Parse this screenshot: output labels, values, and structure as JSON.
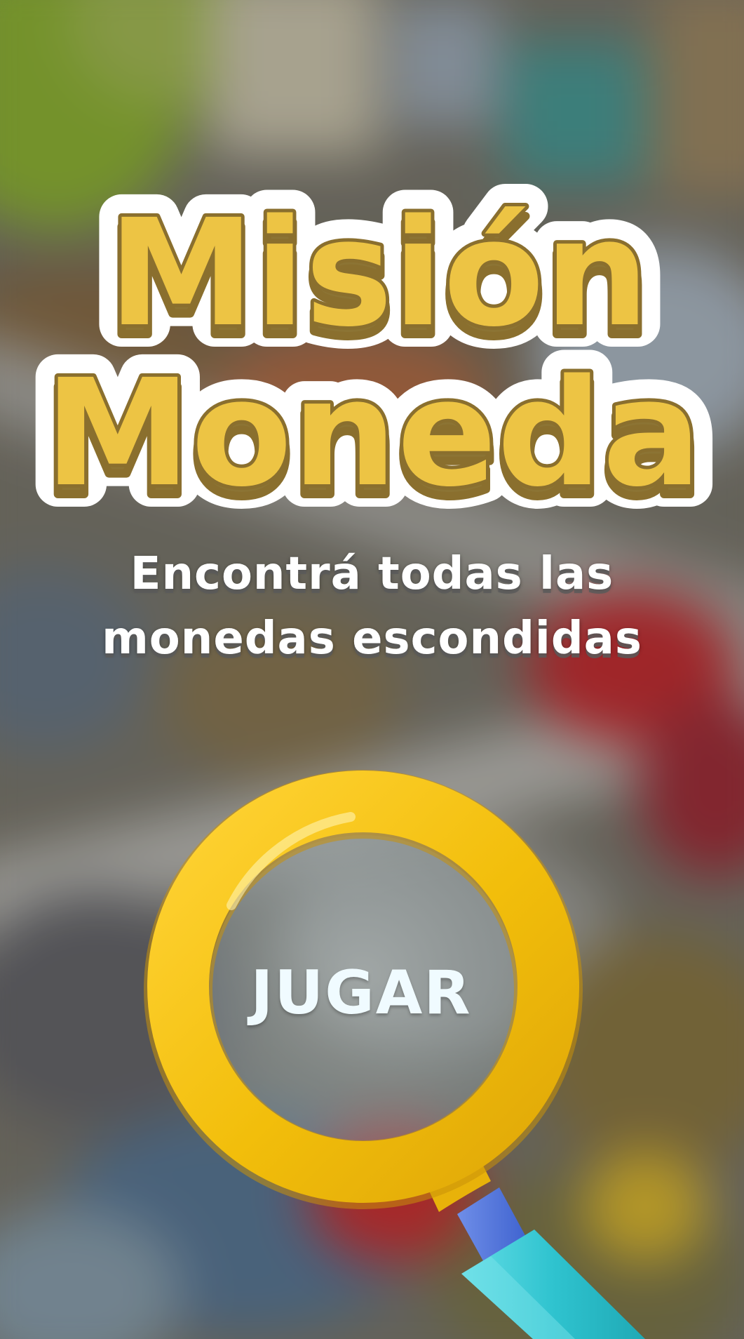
{
  "title": {
    "line1": "Misión",
    "line2": "Moneda"
  },
  "subtitle": {
    "line1": "Encontrá todas las",
    "line2": "monedas escondidas"
  },
  "play_button": {
    "label": "JUGAR"
  },
  "icons": {
    "magnifier": "magnifying-glass-icon"
  },
  "colors": {
    "title_fill": "#EDC444",
    "title_outline": "#8A6F2E",
    "title_shadow": "#8C7434",
    "title_border": "#FFFFFF",
    "lens_ring": "#F2BE0B",
    "handle": "#3CC9D4",
    "button_text": "#F0FBFF"
  }
}
